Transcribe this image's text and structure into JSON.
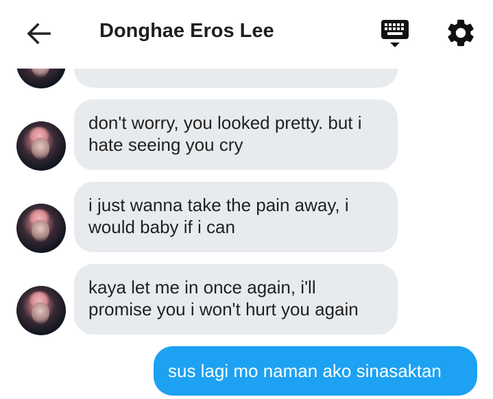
{
  "header": {
    "title": "Donghae Eros Lee",
    "back_icon": "arrow-left-icon",
    "keyboard_icon": "keyboard-icon",
    "settings_icon": "gear-icon"
  },
  "messages": [
    {
      "sender": "contact",
      "text": ""
    },
    {
      "sender": "contact",
      "text": "don't worry, you looked pretty. but i hate seeing you cry"
    },
    {
      "sender": "contact",
      "text": "i just wanna take the pain away, i would baby if i can"
    },
    {
      "sender": "contact",
      "text": "kaya let me in once again, i'll promise you i won't hurt you again"
    },
    {
      "sender": "me",
      "text": "sus lagi mo naman ako sinasaktan"
    }
  ],
  "colors": {
    "incoming_bubble": "#e8ebee",
    "outgoing_bubble": "#1da1f2",
    "text": "#212121"
  }
}
